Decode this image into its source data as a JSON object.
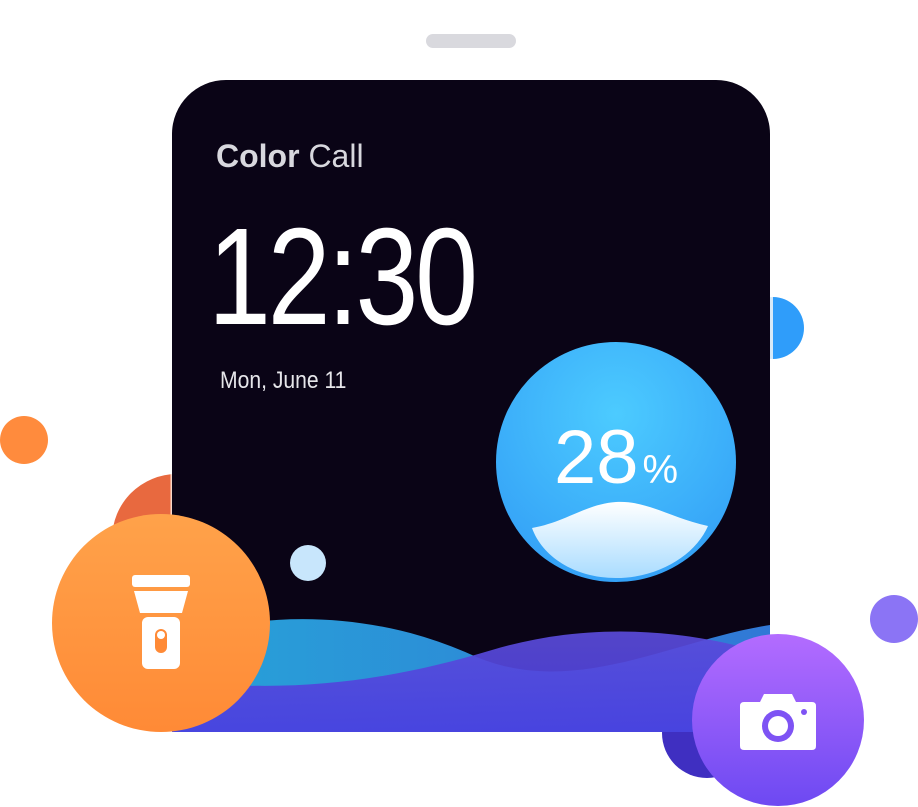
{
  "app": {
    "brand_bold": "Color",
    "brand_light": "Call"
  },
  "lockscreen": {
    "time": "12:30",
    "date": "Mon, June 11"
  },
  "battery": {
    "level": "28",
    "unit": "%",
    "level_fraction": 0.28
  },
  "actions": {
    "flashlight_icon": "flashlight-icon",
    "camera_icon": "camera-icon"
  },
  "colors": {
    "screen_bg": "#0a0416",
    "flash_orange": "#ff8a36",
    "camera_purple": "#8b5cf6",
    "battery_blue": "#2f98f5"
  }
}
